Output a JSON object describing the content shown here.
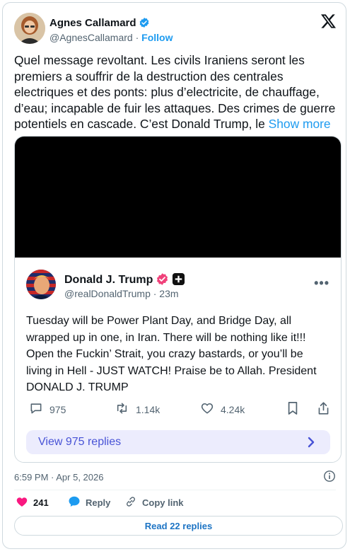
{
  "author": {
    "name": "Agnes Callamard",
    "handle": "@AgnesCallamard",
    "separator": "·",
    "follow_label": "Follow"
  },
  "tweet": {
    "text": "Quel message revoltant.  Les civils Iraniens seront les premiers a souffrir de la destruction des centrales electriques et des ponts: plus d’electricite, de chauffage, d’eau; incapable de fuir les attaques. Des crimes de guerre potentiels en cascade. C’est Donald Trump, le",
    "show_more": "Show more",
    "timestamp": "6:59 PM · Apr 5, 2026"
  },
  "embedded": {
    "name": "Donald J. Trump",
    "handle": "@realDonaldTrump",
    "time": "· 23m",
    "more": "•••",
    "body": "Tuesday will be Power Plant Day, and Bridge Day, all wrapped up in one, in Iran. There will be nothing like it!!! Open the Fuckin’ Strait, you crazy bastards, or you’ll be living in Hell - JUST WATCH! Praise be to Allah. President DONALD J. TRUMP",
    "replies": "975",
    "reposts": "1.14k",
    "likes": "4.24k",
    "view_replies": "View 975 replies"
  },
  "engagement": {
    "likes": "241",
    "reply_label": "Reply",
    "copy_label": "Copy link",
    "read_replies": "Read 22 replies"
  },
  "colors": {
    "accent": "#1d9bf0",
    "like": "#f91880",
    "view_replies_bg": "#ececfd",
    "view_replies_text": "#4853d6"
  },
  "icons": [
    "verified-badge-icon",
    "x-logo-icon",
    "reply-icon",
    "repost-icon",
    "heart-icon",
    "bookmark-icon",
    "share-icon",
    "chevron-right-icon",
    "info-icon",
    "copy-link-icon",
    "more-icon"
  ]
}
